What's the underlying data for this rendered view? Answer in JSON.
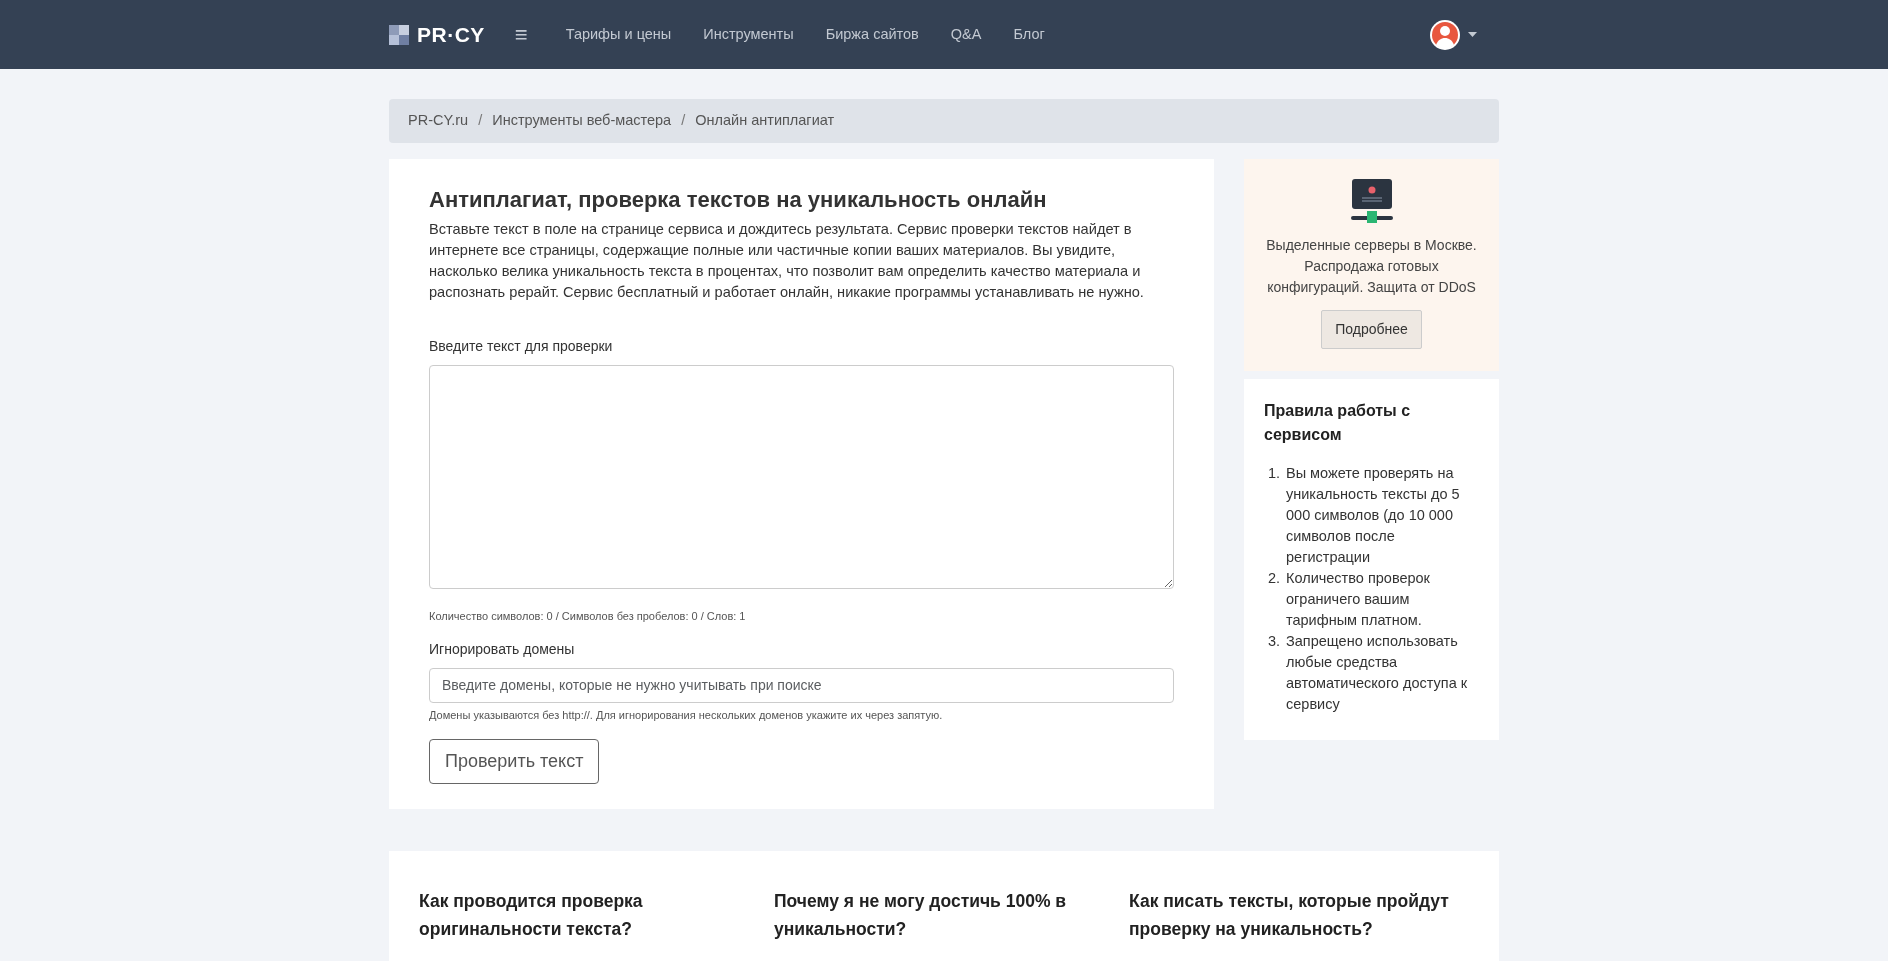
{
  "navbar": {
    "logo": "PR·CY",
    "menu_icon": "≡",
    "links": [
      "Тарифы и цены",
      "Инструменты",
      "Биржа сайтов",
      "Q&A",
      "Блог"
    ]
  },
  "breadcrumb": {
    "separator": "/",
    "items": [
      "PR-CY.ru",
      "Инструменты веб-мастера",
      "Онлайн антиплагиат"
    ]
  },
  "main": {
    "title": "Антиплагиат, проверка текстов на уникальность онлайн",
    "description": "Вставьте текст в поле на странице сервиса и дождитесь результата. Сервис проверки текстов найдет в интернете все страницы, содержащие полные или частичные копии ваших материалов. Вы увидите, насколько велика уникальность текста в процентах, что позволит вам определить качество материала и распознать рерайт. Сервис бесплатный и работает онлайн, никакие программы устанавливать не нужно.",
    "text_label": "Введите текст для проверки",
    "counter": "Количество символов: 0 / Символов без пробелов: 0 / Слов: 1",
    "domains_label": "Игнорировать домены",
    "domains_placeholder": "Введите домены, которые не нужно учитывать при поиске",
    "domains_hint": "Домены указываются без http://. Для игнорирования нескольких доменов укажите их через запятую.",
    "submit": "Проверить текст"
  },
  "ad": {
    "text": "Выделенные серверы в Москве. Распродажа готовых конфигураций. Защита от DDoS",
    "button": "Подробнее"
  },
  "rules": {
    "title": "Правила работы с сервисом",
    "items": [
      {
        "marker": "1.",
        "text": "Вы можете проверять на уникальность тексты до 5 000 символов (до 10 000 символов после регистрации"
      },
      {
        "marker": "2.",
        "text": "Количество проверок ограничего вашим тарифным платном."
      },
      {
        "marker": "3.",
        "text": "Запрещено использовать любые средства автоматического доступа к сервису"
      }
    ]
  },
  "faq": [
    "Как проводится проверка оригинальности текста?",
    "Почему я не могу достичь 100% в уникальности?",
    "Как писать тексты, которые пройдут проверку на уникальность?"
  ]
}
